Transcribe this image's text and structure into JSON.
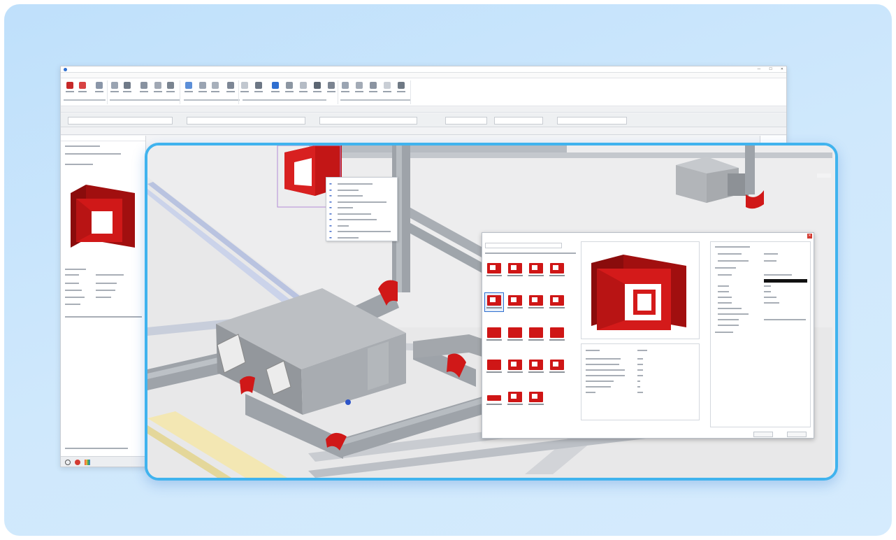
{
  "background_window": {
    "title_bar": {
      "app_logo_icon": "app-logo-icon",
      "window_controls": [
        "—",
        "☐",
        "✕"
      ]
    },
    "ribbon": {
      "button_colors": [
        "#c62828",
        "#d84343",
        "#8a96a8",
        "#9aa4b2",
        "#707a88",
        "#8892a0",
        "#a0a8b4",
        "#7a8490",
        "#5c8fd8",
        "#9aa4b2",
        "#a7b0bb",
        "#7d8795",
        "#c1c7cf",
        "#6d7785",
        "#2f6fd0",
        "#8c96a2",
        "#b5bcc5",
        "#5c6672",
        "#7b8491",
        "#9aa4b2",
        "#a3abb6",
        "#8b94a1",
        "#c9ced5",
        "#6f7984"
      ]
    },
    "left_panel": {
      "preview_color": "#c41a1a"
    },
    "bottom_icons": [
      "settings-icon",
      "record-icon",
      "color-icon"
    ]
  },
  "main_view": {
    "duct_color": "#a3a7ac",
    "fitting_color": "#d01818",
    "highlight_color": "#3fb2ee"
  },
  "fitting_library_dialog": {
    "close_icon": "✕",
    "accent": "#2f6fd0"
  }
}
